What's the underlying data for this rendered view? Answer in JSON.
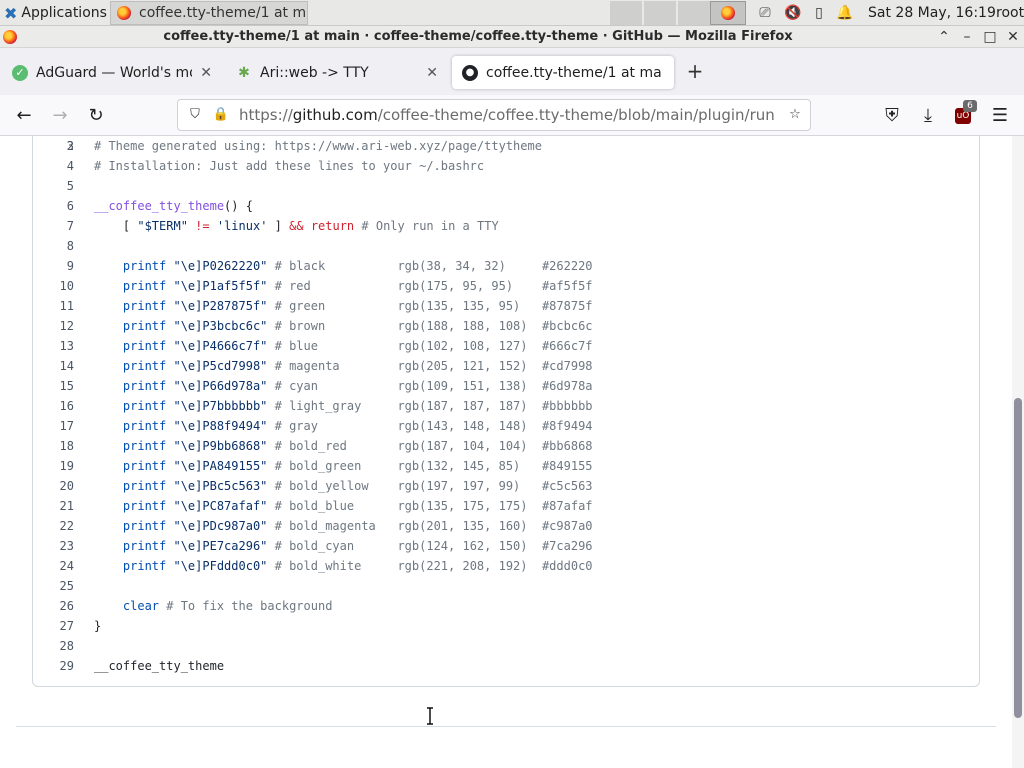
{
  "panel": {
    "applications_label": "Applications",
    "task_label": "coffee.tty-theme/1 at m...",
    "clock": "Sat 28 May, 16:19",
    "user": "root"
  },
  "window": {
    "title": "coffee.tty-theme/1 at main · coffee-theme/coffee.tty-theme · GitHub — Mozilla Firefox"
  },
  "tabs": [
    {
      "label": "AdGuard — World's most",
      "icon": "adguard-icon"
    },
    {
      "label": "Ari::web -> TTY",
      "icon": "ari-web-icon"
    },
    {
      "label": "coffee.tty-theme/1 at ma",
      "icon": "github-icon",
      "active": true
    }
  ],
  "navbar": {
    "url_prefix": "https://",
    "url_host": "github.com",
    "url_path": "/coffee-theme/coffee.tty-theme/blob/main/plugin/runners/",
    "extension_badge": "6"
  },
  "code": {
    "partial_first_line": "2",
    "lines": [
      {
        "n": "3",
        "tokens": [
          {
            "t": "# Theme generated using: https://www.ari-web.xyz/page/ttytheme",
            "c": "c-comment"
          }
        ]
      },
      {
        "n": "4",
        "tokens": [
          {
            "t": "# Installation: Just add these lines to your ~/.bashrc",
            "c": "c-comment"
          }
        ]
      },
      {
        "n": "5",
        "tokens": []
      },
      {
        "n": "6",
        "tokens": [
          {
            "t": "__coffee_tty_theme",
            "c": "c-fn"
          },
          {
            "t": "() {",
            "c": ""
          }
        ]
      },
      {
        "n": "7",
        "tokens": [
          {
            "t": "    [ ",
            "c": ""
          },
          {
            "t": "\"$TERM\"",
            "c": "c-str"
          },
          {
            "t": " ",
            "c": ""
          },
          {
            "t": "!=",
            "c": "c-kw"
          },
          {
            "t": " ",
            "c": ""
          },
          {
            "t": "'linux'",
            "c": "c-str"
          },
          {
            "t": " ] ",
            "c": ""
          },
          {
            "t": "&&",
            "c": "c-kw"
          },
          {
            "t": " ",
            "c": ""
          },
          {
            "t": "return",
            "c": "c-kw"
          },
          {
            "t": " # Only run in a TTY",
            "c": "c-comment"
          }
        ]
      },
      {
        "n": "8",
        "tokens": []
      },
      {
        "n": "9",
        "tokens": [
          {
            "t": "    printf",
            "c": "c-builtin"
          },
          {
            "t": " ",
            "c": ""
          },
          {
            "t": "\"\\e]P0262220\"",
            "c": "c-str"
          },
          {
            "t": " # black          rgb(38, 34, 32)     #262220",
            "c": "c-comment"
          }
        ]
      },
      {
        "n": "10",
        "tokens": [
          {
            "t": "    printf",
            "c": "c-builtin"
          },
          {
            "t": " ",
            "c": ""
          },
          {
            "t": "\"\\e]P1af5f5f\"",
            "c": "c-str"
          },
          {
            "t": " # red            rgb(175, 95, 95)    #af5f5f",
            "c": "c-comment"
          }
        ]
      },
      {
        "n": "11",
        "tokens": [
          {
            "t": "    printf",
            "c": "c-builtin"
          },
          {
            "t": " ",
            "c": ""
          },
          {
            "t": "\"\\e]P287875f\"",
            "c": "c-str"
          },
          {
            "t": " # green          rgb(135, 135, 95)   #87875f",
            "c": "c-comment"
          }
        ]
      },
      {
        "n": "12",
        "tokens": [
          {
            "t": "    printf",
            "c": "c-builtin"
          },
          {
            "t": " ",
            "c": ""
          },
          {
            "t": "\"\\e]P3bcbc6c\"",
            "c": "c-str"
          },
          {
            "t": " # brown          rgb(188, 188, 108)  #bcbc6c",
            "c": "c-comment"
          }
        ]
      },
      {
        "n": "13",
        "tokens": [
          {
            "t": "    printf",
            "c": "c-builtin"
          },
          {
            "t": " ",
            "c": ""
          },
          {
            "t": "\"\\e]P4666c7f\"",
            "c": "c-str"
          },
          {
            "t": " # blue           rgb(102, 108, 127)  #666c7f",
            "c": "c-comment"
          }
        ]
      },
      {
        "n": "14",
        "tokens": [
          {
            "t": "    printf",
            "c": "c-builtin"
          },
          {
            "t": " ",
            "c": ""
          },
          {
            "t": "\"\\e]P5cd7998\"",
            "c": "c-str"
          },
          {
            "t": " # magenta        rgb(205, 121, 152)  #cd7998",
            "c": "c-comment"
          }
        ]
      },
      {
        "n": "15",
        "tokens": [
          {
            "t": "    printf",
            "c": "c-builtin"
          },
          {
            "t": " ",
            "c": ""
          },
          {
            "t": "\"\\e]P66d978a\"",
            "c": "c-str"
          },
          {
            "t": " # cyan           rgb(109, 151, 138)  #6d978a",
            "c": "c-comment"
          }
        ]
      },
      {
        "n": "16",
        "tokens": [
          {
            "t": "    printf",
            "c": "c-builtin"
          },
          {
            "t": " ",
            "c": ""
          },
          {
            "t": "\"\\e]P7bbbbbb\"",
            "c": "c-str"
          },
          {
            "t": " # light_gray     rgb(187, 187, 187)  #bbbbbb",
            "c": "c-comment"
          }
        ]
      },
      {
        "n": "17",
        "tokens": [
          {
            "t": "    printf",
            "c": "c-builtin"
          },
          {
            "t": " ",
            "c": ""
          },
          {
            "t": "\"\\e]P88f9494\"",
            "c": "c-str"
          },
          {
            "t": " # gray           rgb(143, 148, 148)  #8f9494",
            "c": "c-comment"
          }
        ]
      },
      {
        "n": "18",
        "tokens": [
          {
            "t": "    printf",
            "c": "c-builtin"
          },
          {
            "t": " ",
            "c": ""
          },
          {
            "t": "\"\\e]P9bb6868\"",
            "c": "c-str"
          },
          {
            "t": " # bold_red       rgb(187, 104, 104)  #bb6868",
            "c": "c-comment"
          }
        ]
      },
      {
        "n": "19",
        "tokens": [
          {
            "t": "    printf",
            "c": "c-builtin"
          },
          {
            "t": " ",
            "c": ""
          },
          {
            "t": "\"\\e]PA849155\"",
            "c": "c-str"
          },
          {
            "t": " # bold_green     rgb(132, 145, 85)   #849155",
            "c": "c-comment"
          }
        ]
      },
      {
        "n": "20",
        "tokens": [
          {
            "t": "    printf",
            "c": "c-builtin"
          },
          {
            "t": " ",
            "c": ""
          },
          {
            "t": "\"\\e]PBc5c563\"",
            "c": "c-str"
          },
          {
            "t": " # bold_yellow    rgb(197, 197, 99)   #c5c563",
            "c": "c-comment"
          }
        ]
      },
      {
        "n": "21",
        "tokens": [
          {
            "t": "    printf",
            "c": "c-builtin"
          },
          {
            "t": " ",
            "c": ""
          },
          {
            "t": "\"\\e]PC87afaf\"",
            "c": "c-str"
          },
          {
            "t": " # bold_blue      rgb(135, 175, 175)  #87afaf",
            "c": "c-comment"
          }
        ]
      },
      {
        "n": "22",
        "tokens": [
          {
            "t": "    printf",
            "c": "c-builtin"
          },
          {
            "t": " ",
            "c": ""
          },
          {
            "t": "\"\\e]PDc987a0\"",
            "c": "c-str"
          },
          {
            "t": " # bold_magenta   rgb(201, 135, 160)  #c987a0",
            "c": "c-comment"
          }
        ]
      },
      {
        "n": "23",
        "tokens": [
          {
            "t": "    printf",
            "c": "c-builtin"
          },
          {
            "t": " ",
            "c": ""
          },
          {
            "t": "\"\\e]PE7ca296\"",
            "c": "c-str"
          },
          {
            "t": " # bold_cyan      rgb(124, 162, 150)  #7ca296",
            "c": "c-comment"
          }
        ]
      },
      {
        "n": "24",
        "tokens": [
          {
            "t": "    printf",
            "c": "c-builtin"
          },
          {
            "t": " ",
            "c": ""
          },
          {
            "t": "\"\\e]PFddd0c0\"",
            "c": "c-str"
          },
          {
            "t": " # bold_white     rgb(221, 208, 192)  #ddd0c0",
            "c": "c-comment"
          }
        ]
      },
      {
        "n": "25",
        "tokens": []
      },
      {
        "n": "26",
        "tokens": [
          {
            "t": "    clear",
            "c": "c-builtin"
          },
          {
            "t": " # To fix the background",
            "c": "c-comment"
          }
        ]
      },
      {
        "n": "27",
        "tokens": [
          {
            "t": "}",
            "c": ""
          }
        ]
      },
      {
        "n": "28",
        "tokens": []
      },
      {
        "n": "29",
        "tokens": [
          {
            "t": "__coffee_tty_theme",
            "c": ""
          }
        ]
      }
    ]
  },
  "colors": {
    "comment": "#6e7781",
    "function": "#8250df",
    "keyword": "#cf222e",
    "string": "#0a3069",
    "builtin": "#0550ae"
  }
}
